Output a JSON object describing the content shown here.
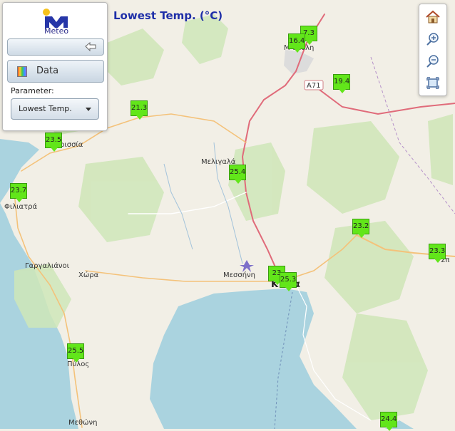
{
  "title": "Lowest Temp. (°C)",
  "logo": {
    "text": "Meteo"
  },
  "panel": {
    "data_button_label": "Data",
    "parameter_label": "Parameter:",
    "parameter_select_value": "Lowest Temp."
  },
  "toolbar": {
    "buttons": [
      "home-icon",
      "zoom-in-icon",
      "zoom-out-icon",
      "fit-extent-icon"
    ]
  },
  "map": {
    "road_label": "A71",
    "places": [
      {
        "name": "Μεγαλόπολη (partially hidden)",
        "shown": "Μ      οπολη"
      },
      {
        "name": "Μελιγαλάς",
        "shown": "Μελιγαλά"
      },
      {
        "name": "Κυπαρισσία",
        "shown": "ρισσία"
      },
      {
        "name": "Φιλιατρά",
        "shown": "Φιλιατρά"
      },
      {
        "name": "Γαργαλιάνοι",
        "shown": "Γαργαλιάνοι"
      },
      {
        "name": "Χώρα",
        "shown": "Χώρα"
      },
      {
        "name": "Μεσσήνη",
        "shown": "Μεσσήνη"
      },
      {
        "name": "Καλαμάτα",
        "shown": "Κ        άτα"
      },
      {
        "name": "Πύλος",
        "shown": "Πύλος"
      },
      {
        "name": "Μεθώνη",
        "shown": "Μεθώνη"
      },
      {
        "name": "Σπάρτη (cut)",
        "shown": "Σπ"
      }
    ],
    "stations": [
      {
        "value": "7.3"
      },
      {
        "value": "16.4"
      },
      {
        "value": "19.4"
      },
      {
        "value": "21.3"
      },
      {
        "value": "23.5"
      },
      {
        "value": "25.4"
      },
      {
        "value": "23.7"
      },
      {
        "value": "23.2"
      },
      {
        "value": "23.3"
      },
      {
        "value": "23"
      },
      {
        "value": "25.3"
      },
      {
        "value": "25.5"
      },
      {
        "value": "24.4"
      }
    ]
  },
  "colors": {
    "marker": "#62e61a",
    "title": "#1f2fa8",
    "sea": "#aad3df",
    "land": "#f2efe6"
  }
}
